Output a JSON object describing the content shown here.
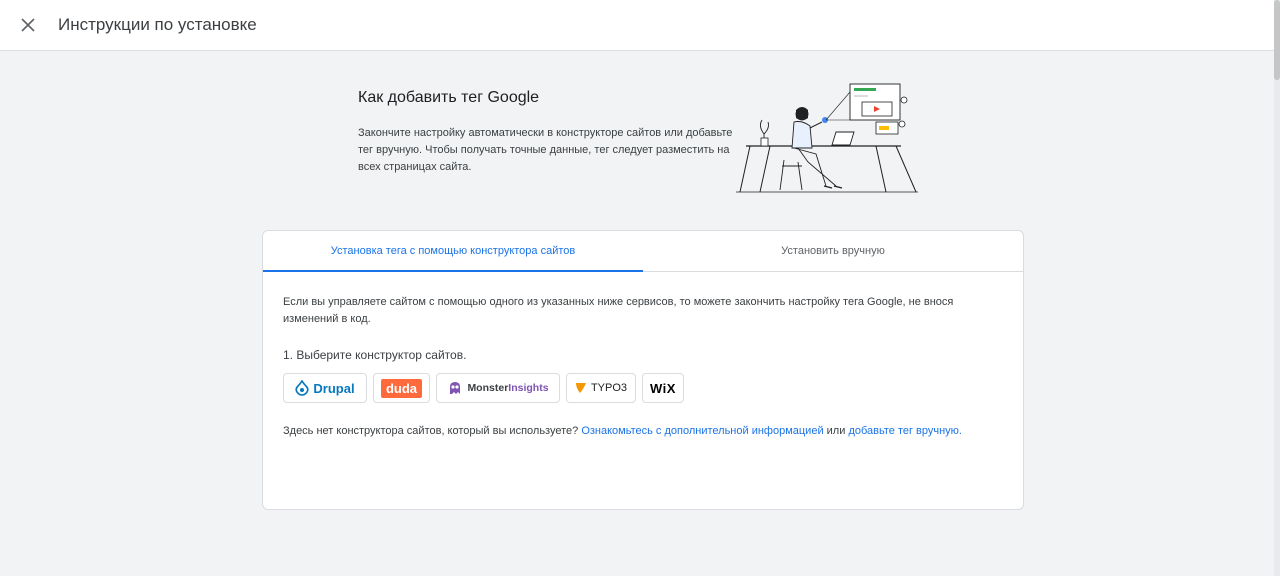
{
  "header": {
    "title": "Инструкции по установке",
    "close_icon": "close-icon"
  },
  "hero": {
    "title": "Как добавить тег Google",
    "description": "Закончите настройку автоматически в конструкторе сайтов или добавьте тег вручную. Чтобы получать точные данные, тег следует разместить на всех страницах сайта."
  },
  "tabs": [
    {
      "label": "Установка тега с помощью конструктора сайтов",
      "active": true
    },
    {
      "label": "Установить вручную",
      "active": false
    }
  ],
  "content": {
    "intro": "Если вы управляете сайтом с помощью одного из указанных ниже сервисов, то можете закончить настройку тега Google, не внося изменений в код.",
    "step": "1. Выберите конструктор сайтов.",
    "builders": [
      {
        "name": "Drupal",
        "color": "#0678be"
      },
      {
        "name": "duda",
        "color": "#ff6a3d"
      },
      {
        "name_part1": "Monster",
        "name_part2": "Insights",
        "color": "#7f54b3"
      },
      {
        "name": "TYPO3",
        "color": "#f49700"
      },
      {
        "name": "WiX",
        "color": "#000000"
      }
    ],
    "footer_prefix": "Здесь нет конструктора сайтов, который вы используете?",
    "footer_link1": "Ознакомьтесь с дополнительной информацией",
    "footer_middle": "или",
    "footer_link2": "добавьте тег вручную."
  },
  "colors": {
    "accent": "#1a73e8",
    "background": "#f1f3f4"
  }
}
